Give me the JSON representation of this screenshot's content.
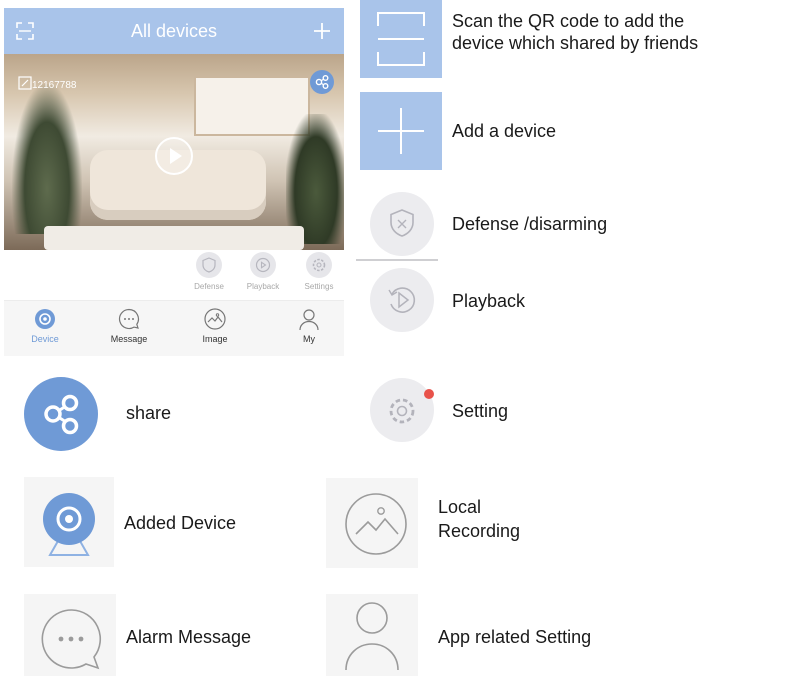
{
  "app": {
    "title": "All devices",
    "device_id": "12167788",
    "controls": [
      {
        "label": "Defense",
        "icon": "shield-icon"
      },
      {
        "label": "Playback",
        "icon": "playback-icon"
      },
      {
        "label": "Settings",
        "icon": "gear-icon"
      }
    ],
    "tabs": [
      {
        "label": "Device",
        "icon": "device-icon",
        "active": true
      },
      {
        "label": "Message",
        "icon": "message-icon",
        "active": false
      },
      {
        "label": "Image",
        "icon": "image-icon",
        "active": false
      },
      {
        "label": "My",
        "icon": "user-icon",
        "active": false
      }
    ]
  },
  "legend": {
    "scan": {
      "line1": "Scan the QR code to add the",
      "line2": "device which shared by friends",
      "icon": "scan-icon"
    },
    "add": {
      "text": "Add a device",
      "icon": "plus-icon"
    },
    "defense": {
      "text": "Defense /disarming",
      "icon": "shield-icon"
    },
    "playback": {
      "text": "Playback",
      "icon": "playback-icon"
    },
    "share": {
      "text": "share",
      "icon": "share-icon"
    },
    "setting": {
      "text": "Setting",
      "icon": "gear-icon"
    },
    "added_device": {
      "text": "Added Device",
      "icon": "camera-icon"
    },
    "local_recording": {
      "line1": "Local",
      "line2": "Recording",
      "icon": "image-icon"
    },
    "alarm_message": {
      "text": "Alarm Message",
      "icon": "message-icon"
    },
    "app_setting": {
      "text": "App related Setting",
      "icon": "user-icon"
    }
  },
  "colors": {
    "accent": "#a9c4ea",
    "active": "#6f9ad6",
    "badge": "#e8524a"
  }
}
